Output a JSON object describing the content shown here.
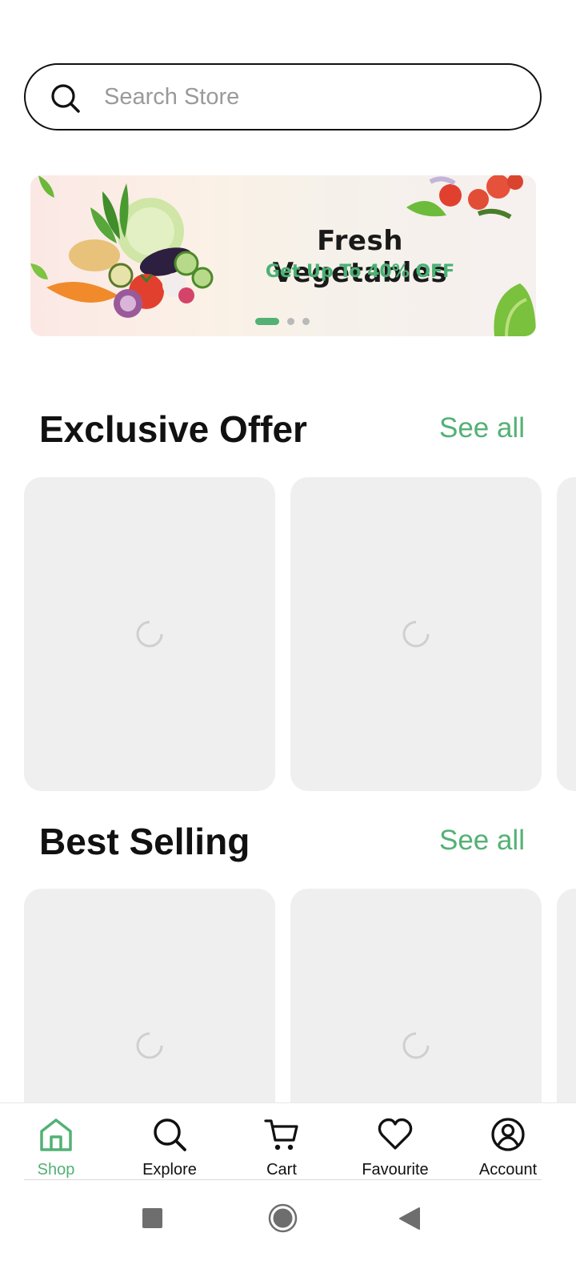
{
  "search": {
    "placeholder": "Search Store",
    "icon": "search-icon"
  },
  "banner": {
    "title": "Fresh Vegetables",
    "subtitle": "Get Up To 40% OFF",
    "pages": 3,
    "active_page": 1
  },
  "sections": [
    {
      "title": "Exclusive Offer",
      "see_all": "See all",
      "cards_loading": true
    },
    {
      "title": "Best Selling",
      "see_all": "See all",
      "cards_loading": true
    }
  ],
  "tabs": [
    {
      "label": "Shop",
      "icon": "home-icon",
      "active": true
    },
    {
      "label": "Explore",
      "icon": "search-icon",
      "active": false
    },
    {
      "label": "Cart",
      "icon": "cart-icon",
      "active": false
    },
    {
      "label": "Favourite",
      "icon": "heart-icon",
      "active": false
    },
    {
      "label": "Account",
      "icon": "account-icon",
      "active": false
    }
  ],
  "colors": {
    "accent": "#53b175",
    "card_bg": "#efefef",
    "text": "#111111"
  }
}
